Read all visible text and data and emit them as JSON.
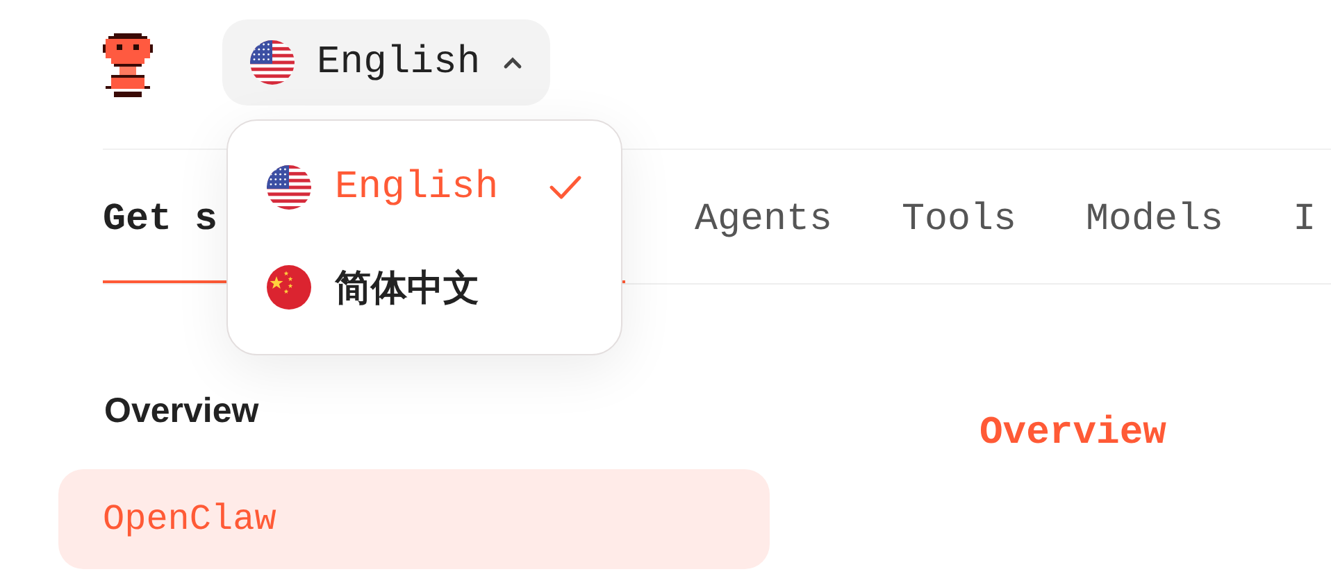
{
  "language_button": {
    "label": "English",
    "kind": "us",
    "expanded": true
  },
  "language_menu": [
    {
      "label": "English",
      "kind": "us",
      "selected": true
    },
    {
      "label": "简体中文",
      "kind": "cn",
      "selected": false
    }
  ],
  "tabs": [
    {
      "label": "Get s",
      "selected": true
    },
    {
      "label": "Agents",
      "selected": false
    },
    {
      "label": "Tools",
      "selected": false
    },
    {
      "label": "Models",
      "selected": false
    },
    {
      "label": "I",
      "selected": false
    }
  ],
  "sidebar": {
    "heading": "Overview",
    "items": [
      {
        "label": "OpenClaw",
        "selected": true
      }
    ]
  },
  "content": {
    "heading": "Overview"
  }
}
